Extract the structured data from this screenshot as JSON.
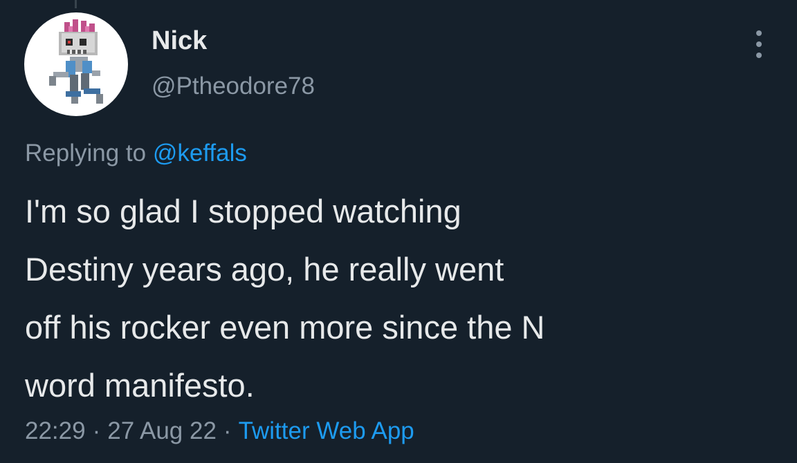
{
  "user": {
    "display_name": "Nick",
    "handle": "@Ptheodore78",
    "avatar_icon": "pixel-skull-zombie-avatar"
  },
  "reply": {
    "prefix": "Replying to",
    "mention": "@keffals"
  },
  "tweet": {
    "lines": [
      "I'm so glad I stopped watching",
      "Destiny years ago, he really went",
      "off his rocker even more since the N",
      "word manifesto."
    ]
  },
  "meta": {
    "time": "22:29",
    "date": "27 Aug 22",
    "source": "Twitter Web App",
    "separator": "·"
  },
  "colors": {
    "background": "#15202b",
    "text": "#e7e9ea",
    "secondary": "#8b98a5",
    "accent": "#1d9bf0"
  }
}
